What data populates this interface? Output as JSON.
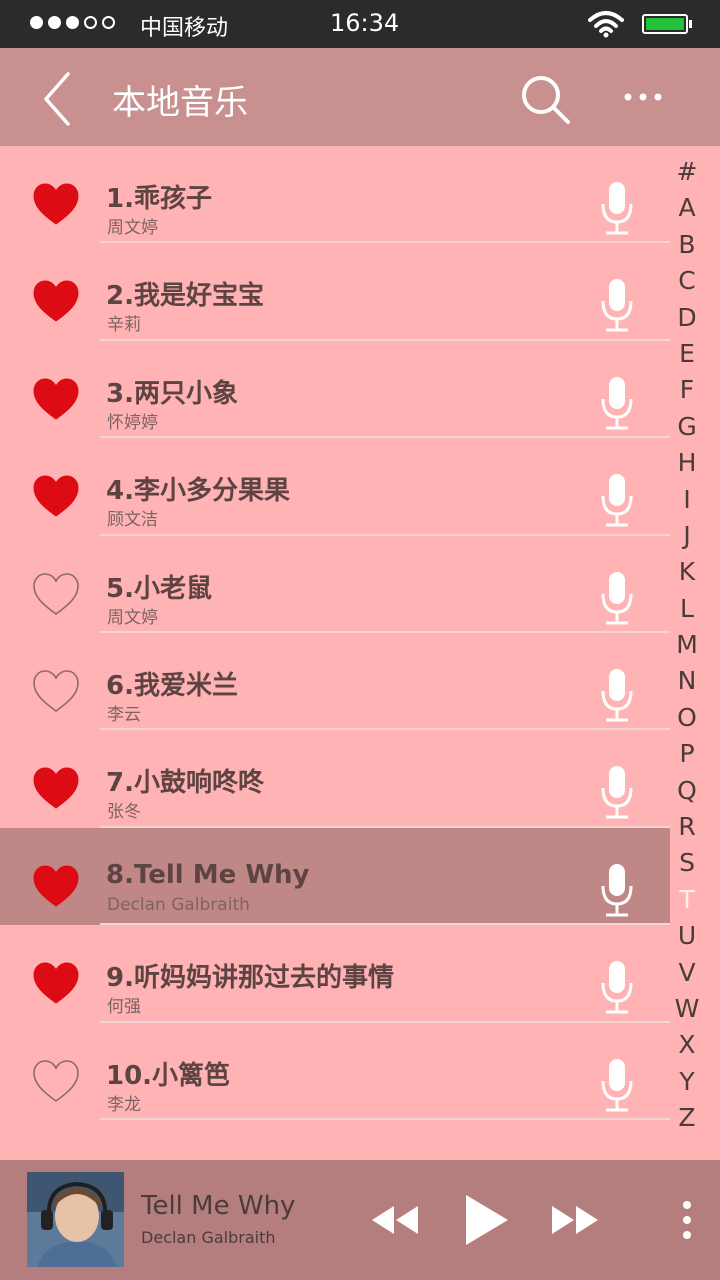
{
  "status_bar": {
    "carrier": "中国移动",
    "time": "16:34",
    "signal_bars": 3,
    "signal_total": 5,
    "battery_color": "#22c33a"
  },
  "header": {
    "title": "本地音乐",
    "back_icon": "chevron-left-icon",
    "search_icon": "search-icon",
    "more_icon": "more-dots-icon"
  },
  "songs": [
    {
      "title": "1.乖孩子",
      "artist": "周文婷",
      "favorite": true
    },
    {
      "title": "2.我是好宝宝",
      "artist": "辛莉",
      "favorite": true
    },
    {
      "title": "3.两只小象",
      "artist": "怀婷婷",
      "favorite": true
    },
    {
      "title": "4.李小多分果果",
      "artist": "顾文洁",
      "favorite": true
    },
    {
      "title": "5.小老鼠",
      "artist": "周文婷",
      "favorite": false
    },
    {
      "title": "6.我爱米兰",
      "artist": "李云",
      "favorite": false
    },
    {
      "title": "7.小鼓响咚咚",
      "artist": "张冬",
      "favorite": true
    },
    {
      "title": "8.Tell Me Why",
      "artist": "Declan Galbraith",
      "favorite": true,
      "active": true
    },
    {
      "title": "9.听妈妈讲那过去的事情",
      "artist": "何强",
      "favorite": true
    },
    {
      "title": "10.小篱笆",
      "artist": "李龙",
      "favorite": false
    }
  ],
  "alphabet": [
    "#",
    "A",
    "B",
    "C",
    "D",
    "E",
    "F",
    "G",
    "H",
    "I",
    "J",
    "K",
    "L",
    "M",
    "N",
    "O",
    "P",
    "Q",
    "R",
    "S",
    "T",
    "U",
    "V",
    "W",
    "X",
    "Y",
    "Z"
  ],
  "alphabet_selected": "T",
  "now_playing": {
    "title": "Tell Me Why",
    "artist": "Declan  Galbraith"
  },
  "colors": {
    "background": "#ffb3b4",
    "header": "#c99090",
    "active_row": "#c08787",
    "player": "#b57e7e",
    "heart": "#dd0b14"
  }
}
